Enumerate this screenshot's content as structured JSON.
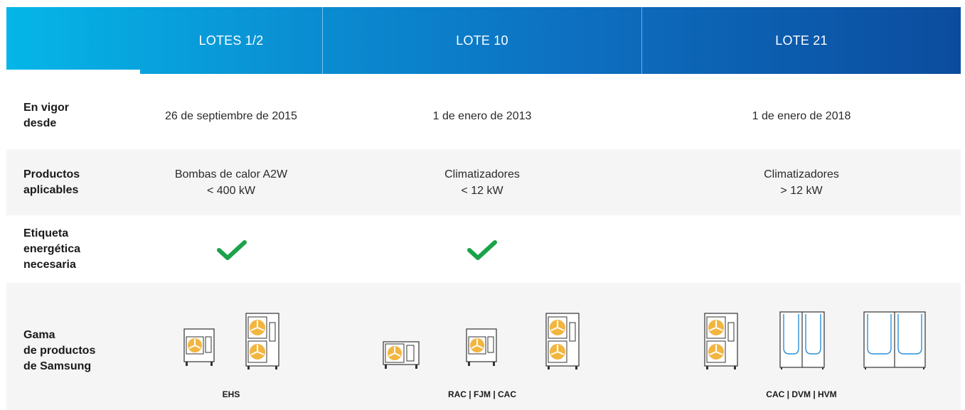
{
  "header": {
    "columns": [
      "LOTES 1/2",
      "LOTE 10",
      "LOTE 21"
    ]
  },
  "rows": {
    "en_vigor": {
      "label": "En vigor\ndesde",
      "values": [
        "26 de septiembre de 2015",
        "1 de enero de 2013",
        "1 de enero de 2018"
      ]
    },
    "productos": {
      "label": "Productos\naplicables",
      "values": [
        {
          "line1": "Bombas de calor A2W",
          "line2": "< 400 kW"
        },
        {
          "line1": "Climatizadores",
          "line2": "< 12 kW"
        },
        {
          "line1": "Climatizadores",
          "line2": "> 12 kW"
        }
      ]
    },
    "etiqueta": {
      "label": "Etiqueta\nenergética\nnecesaria",
      "required": [
        true,
        true,
        false
      ]
    },
    "gama": {
      "label": "Gama\nde productos\nde Samsung",
      "captions": [
        "EHS",
        "RAC | FJM | CAC",
        "CAC | DVM | HVM"
      ]
    }
  },
  "colors": {
    "header_start": "#05b6e8",
    "header_end": "#0c4c9e",
    "row_band": "#f5f5f5",
    "check": "#1aa34a",
    "fan": "#f2b640",
    "unit_accent": "#2a8fd8"
  },
  "icons": [
    "checkmark-icon",
    "outdoor-unit-icon",
    "hvm-unit-icon"
  ]
}
